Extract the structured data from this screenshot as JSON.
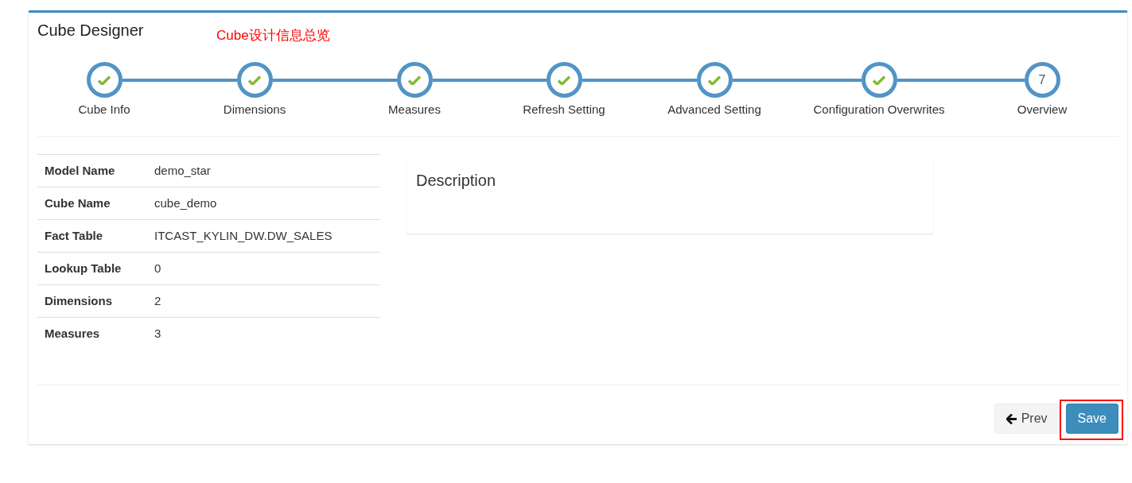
{
  "card": {
    "title": "Cube Designer",
    "annotation": "Cube设计信息总览"
  },
  "steps": [
    {
      "label": "Cube Info",
      "completed": true
    },
    {
      "label": "Dimensions",
      "completed": true
    },
    {
      "label": "Measures",
      "completed": true
    },
    {
      "label": "Refresh Setting",
      "completed": true
    },
    {
      "label": "Advanced Setting",
      "completed": true
    },
    {
      "label": "Configuration Overwrites",
      "completed": true
    },
    {
      "label": "Overview",
      "completed": false,
      "number": "7"
    }
  ],
  "summary": {
    "rows": [
      {
        "label": "Model Name",
        "value": "demo_star"
      },
      {
        "label": "Cube Name",
        "value": "cube_demo"
      },
      {
        "label": "Fact Table",
        "value": "ITCAST_KYLIN_DW.DW_SALES"
      },
      {
        "label": "Lookup Table",
        "value": "0"
      },
      {
        "label": "Dimensions",
        "value": "2"
      },
      {
        "label": "Measures",
        "value": "3"
      }
    ]
  },
  "description": {
    "title": "Description"
  },
  "buttons": [
    {
      "kind": "back",
      "label": "Prev"
    },
    {
      "kind": "primary",
      "label": "Save",
      "highlighted": true
    }
  ]
}
